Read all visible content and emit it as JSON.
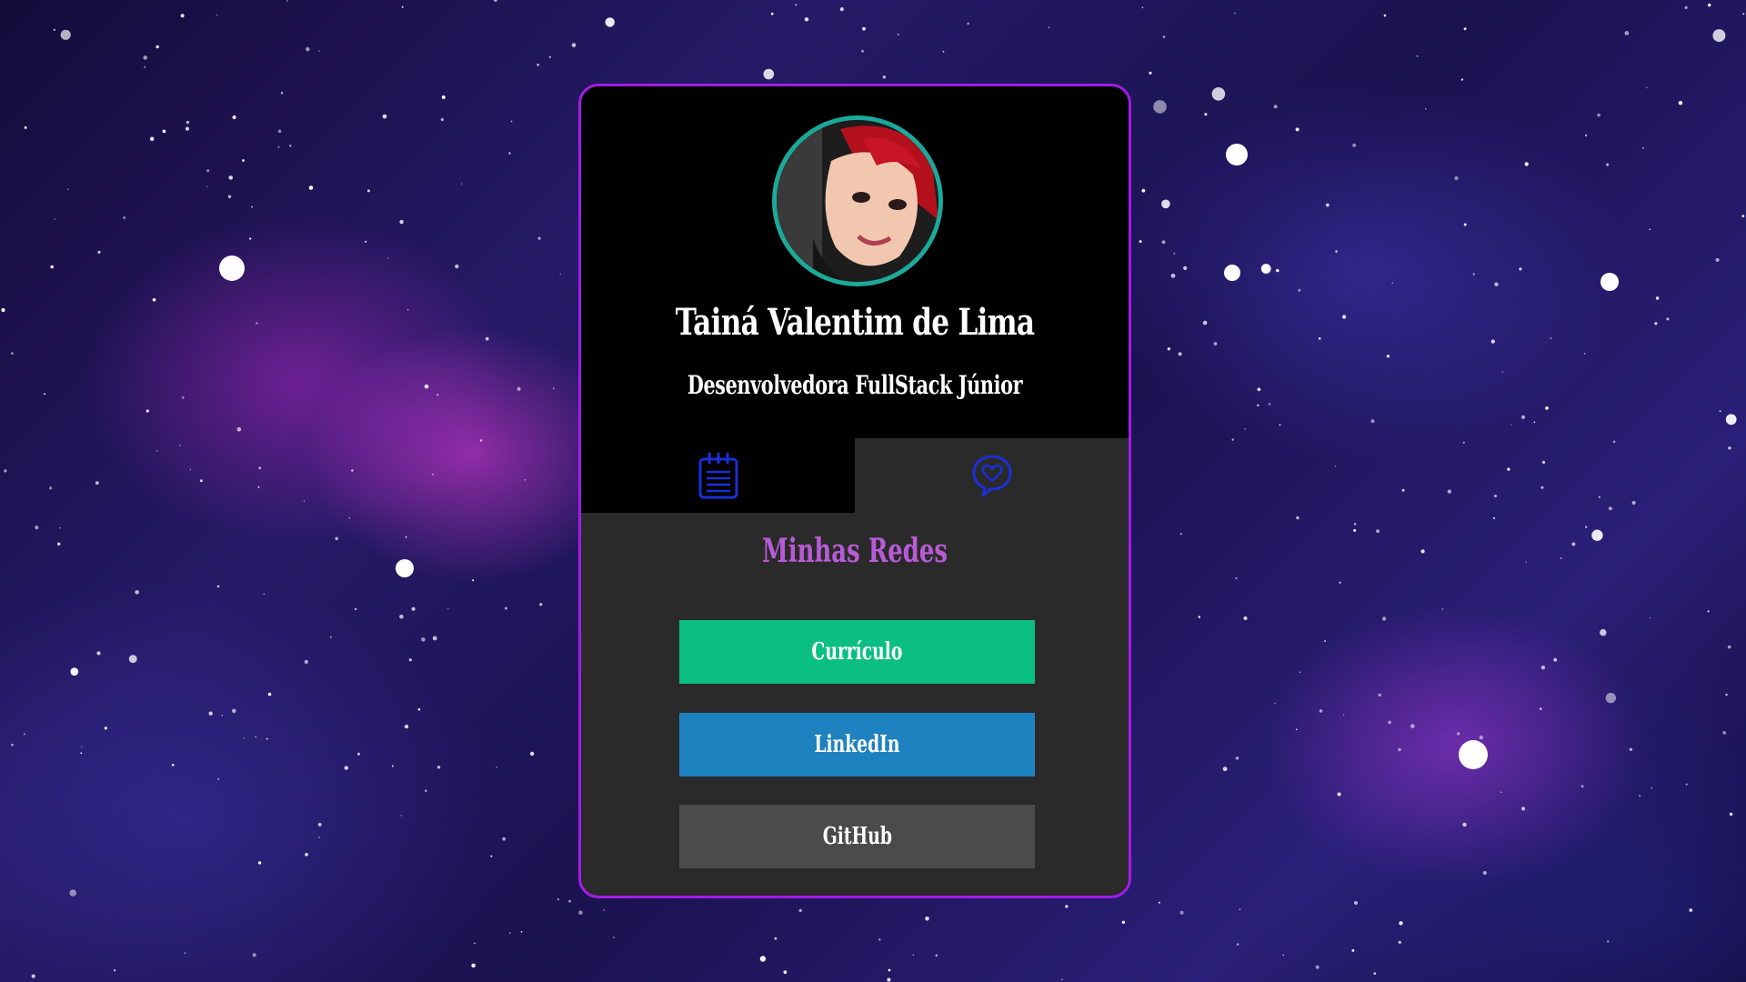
{
  "profile": {
    "name": "Tainá Valentim de Lima",
    "role": "Desenvolvedora FullStack Júnior",
    "avatar_icon": "profile-photo"
  },
  "tabs": [
    {
      "icon": "notepad-icon",
      "active": false
    },
    {
      "icon": "chat-heart-icon",
      "active": true
    }
  ],
  "section": {
    "title": "Minhas Redes"
  },
  "links": {
    "curriculo": "Currículo",
    "linkedin": "LinkedIn",
    "github": "GitHub"
  },
  "colors": {
    "card_border": "#a21ce8",
    "avatar_ring": "#1ba99a",
    "section_title": "#b85bd6",
    "curriculo": "#0bbf83",
    "linkedin": "#1e82c0",
    "github": "#4b4b4b",
    "tab_icon": "#1a2fd6"
  }
}
